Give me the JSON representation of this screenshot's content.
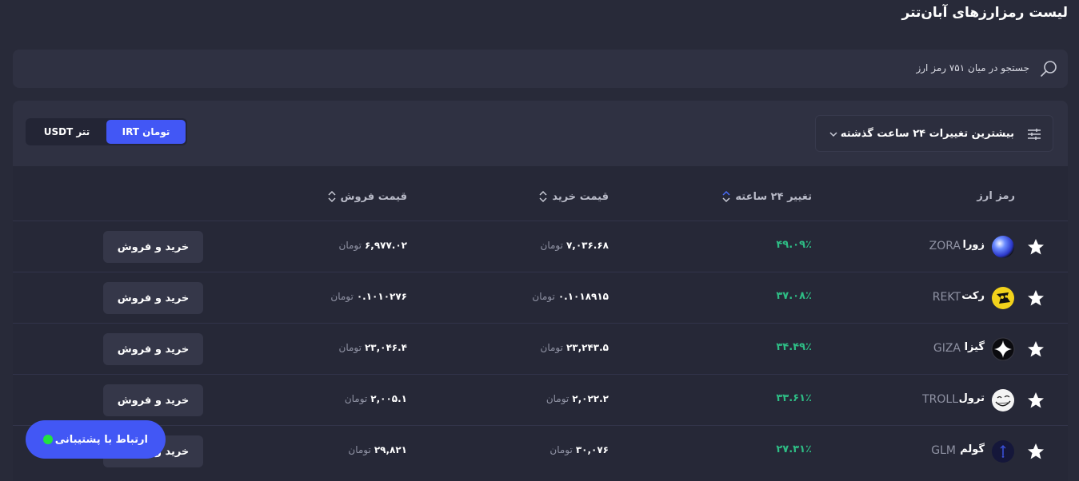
{
  "page": {
    "title": "لیست رمزارزهای آبان‌تتر"
  },
  "search": {
    "placeholder": "جستجو در میان ۷۵۱ رمز ارز"
  },
  "filters": {
    "sort_label": "بیشترین تغییرات ۲۴ ساعت گذشته",
    "currency_options": [
      {
        "label": "تومان IRT",
        "selected": true
      },
      {
        "label": "تتر USDT",
        "selected": false
      }
    ]
  },
  "table": {
    "headers": {
      "coin": "رمز ارز",
      "change": "تغییر ۲۴ ساعته",
      "buy": "قیمت خرید",
      "sell": "قیمت فروش"
    },
    "unit": "تومان",
    "action_label": "خرید و فروش",
    "rows": [
      {
        "name": "زورا",
        "symbol": "ZORA",
        "change": "۴۹.۰۹٪",
        "buy": "۷,۰۳۶.۶۸",
        "sell": "۶,۹۷۷.۰۲",
        "icon": "zora-icon"
      },
      {
        "name": "رکت",
        "symbol": "REKT",
        "change": "۳۷.۰۸٪",
        "buy": "۰.۱۰۱۸۹۱۵",
        "sell": "۰.۱۰۱۰۲۷۶",
        "icon": "rekt-icon"
      },
      {
        "name": "گیزا",
        "symbol": "GIZA",
        "change": "۳۴.۴۹٪",
        "buy": "۲۳,۲۴۳.۵",
        "sell": "۲۳,۰۴۶.۴",
        "icon": "giza-icon"
      },
      {
        "name": "ترول",
        "symbol": "TROLL",
        "change": "۳۳.۶۱٪",
        "buy": "۲,۰۲۲.۲",
        "sell": "۲,۰۰۵.۱",
        "icon": "troll-icon"
      },
      {
        "name": "گولم",
        "symbol": "GLM",
        "change": "۲۷.۳۱٪",
        "buy": "۳۰,۰۷۶",
        "sell": "۲۹,۸۲۱",
        "icon": "golem-icon"
      }
    ]
  },
  "support": {
    "label": "ارتباط با پشتیبانی",
    "status_color": "#22e33f"
  },
  "colors": {
    "accent": "#4257f5",
    "positive": "#2ebd85",
    "background": "#282a39"
  }
}
